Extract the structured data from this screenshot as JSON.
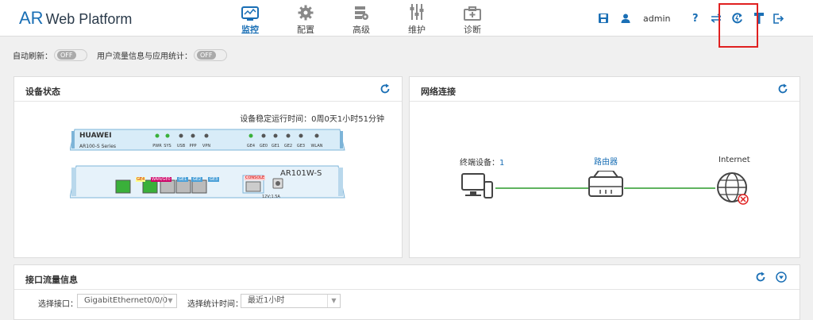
{
  "app": {
    "brand_ar": "AR",
    "brand_rest": "Web Platform"
  },
  "nav": [
    {
      "label": "监控",
      "icon": "monitor-icon",
      "active": true
    },
    {
      "label": "配置",
      "icon": "gear-icon",
      "active": false
    },
    {
      "label": "高级",
      "icon": "advanced-icon",
      "active": false
    },
    {
      "label": "维护",
      "icon": "sliders-icon",
      "active": false
    },
    {
      "label": "诊断",
      "icon": "toolbox-icon",
      "active": false
    }
  ],
  "header": {
    "user": "admin",
    "icons": [
      "save-icon",
      "user-icon",
      "help-icon",
      "switch-icon",
      "restart-icon",
      "wizard-icon",
      "logout-icon"
    ]
  },
  "toggles": {
    "auto_refresh_label": "自动刷新：",
    "auto_refresh_state": "OFF",
    "traffic_label": "用户流量信息与应用统计：",
    "traffic_state": "OFF"
  },
  "device_panel": {
    "title": "设备状态",
    "uptime": "设备稳定运行时间：0周0天1小时51分钟",
    "brand": "HUAWEI",
    "series": "AR100-S Series",
    "model": "AR101W-S",
    "leds": [
      "PWR",
      "SYS",
      "USB",
      "PPP",
      "VPN",
      "GE4",
      "GE0",
      "GE1",
      "GE2",
      "GE3",
      "WLAN"
    ],
    "ports": [
      "GE4",
      "GE0",
      "GE1",
      "GE2",
      "GE3"
    ],
    "port_tag": "WAN/GE0",
    "console": "CONSOLE",
    "power": "12V;1.5A"
  },
  "network_panel": {
    "title": "网络连接",
    "terminal_label": "终端设备：",
    "terminal_count": "1",
    "router_label": "路由器",
    "internet_label": "Internet"
  },
  "interface_panel": {
    "title": "接口流量信息",
    "iface_label": "选择接口：",
    "iface_value": "GigabitEthernet0/0/0",
    "time_label": "选择统计时间：",
    "time_value": "最近1小时"
  },
  "colors": {
    "accent": "#1a6fb5",
    "link_line": "#2a9a2a",
    "led": "#3ab03a",
    "alert": "#e02020"
  }
}
